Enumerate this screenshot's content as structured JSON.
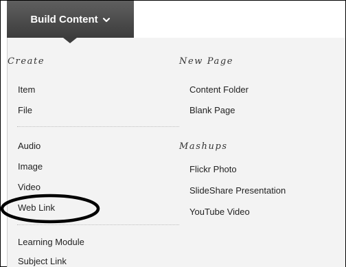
{
  "build_button": {
    "label": "Build Content",
    "icon": "chevron-down-icon"
  },
  "menu": {
    "create_heading": "Create",
    "create_items": [
      "Item",
      "File"
    ],
    "media_items": [
      "Audio",
      "Image",
      "Video",
      "Web Link"
    ],
    "module_items": [
      "Learning Module",
      "Subject Link"
    ],
    "new_page_heading": "New Page",
    "new_page_items": [
      "Content Folder",
      "Blank Page"
    ],
    "mashups_heading": "Mashups",
    "mashups_items": [
      "Flickr Photo",
      "SlideShare Presentation",
      "YouTube Video"
    ]
  },
  "colors": {
    "button_bg": "#474747",
    "panel_bg": "#f3f3f3",
    "highlight_ellipse": "#000000"
  }
}
